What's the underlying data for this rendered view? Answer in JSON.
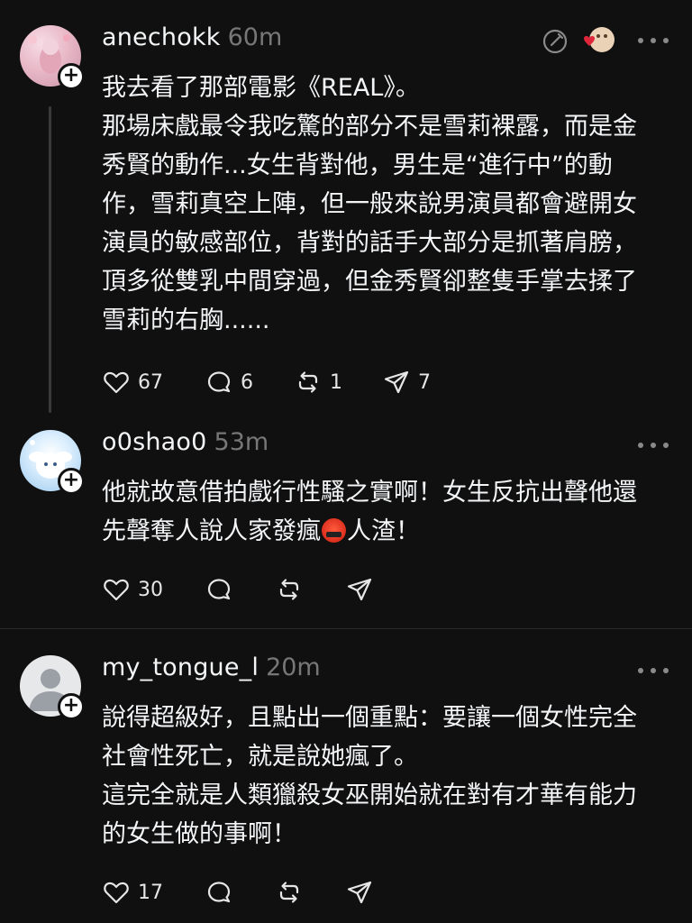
{
  "posts": [
    {
      "username": "anechokk",
      "timestamp": "60m",
      "lines": [
        "我去看了那部電影《REAL》。",
        "那場床戲最令我吃驚的部分不是雪莉裸露，而是金",
        "秀賢的動作...女生背對他，男生是“進行中”的動",
        "作，雪莉真空上陣，但一般來說男演員都會避開女",
        "演員的敏感部位，背對的話手大部分是抓著肩膀，",
        "頂多從雙乳中間穿過，但金秀賢卻整隻手掌去揉了",
        "雪莉的右胸......"
      ],
      "likes": "67",
      "replies": "6",
      "reposts": "1",
      "shares": "7"
    },
    {
      "username": "o0shao0",
      "timestamp": "53m",
      "line1": "他就故意借拍戲行性騷之實啊！女生反抗出聲他還",
      "line2_before": "先聲奪人說人家發瘋",
      "line2_after": "人渣！",
      "likes": "30"
    },
    {
      "username": "my_tongue_l",
      "timestamp": "20m",
      "lines": [
        "說得超級好，且點出一個重點：要讓一個女性完全",
        "社會性死亡，就是說她瘋了。",
        "這完全就是人類獵殺女巫開始就在對有才華有能力",
        "的女生做的事啊！"
      ],
      "likes": "17"
    }
  ],
  "colors": {
    "background": "#101010",
    "text": "#f3f5f7",
    "muted": "#777777",
    "thread_line": "#3a3a3a",
    "heart_red": "#e0263a"
  },
  "icons": [
    "heart-icon",
    "comment-icon",
    "repost-icon",
    "share-icon",
    "more-icon",
    "edit-icon",
    "plus-icon"
  ]
}
